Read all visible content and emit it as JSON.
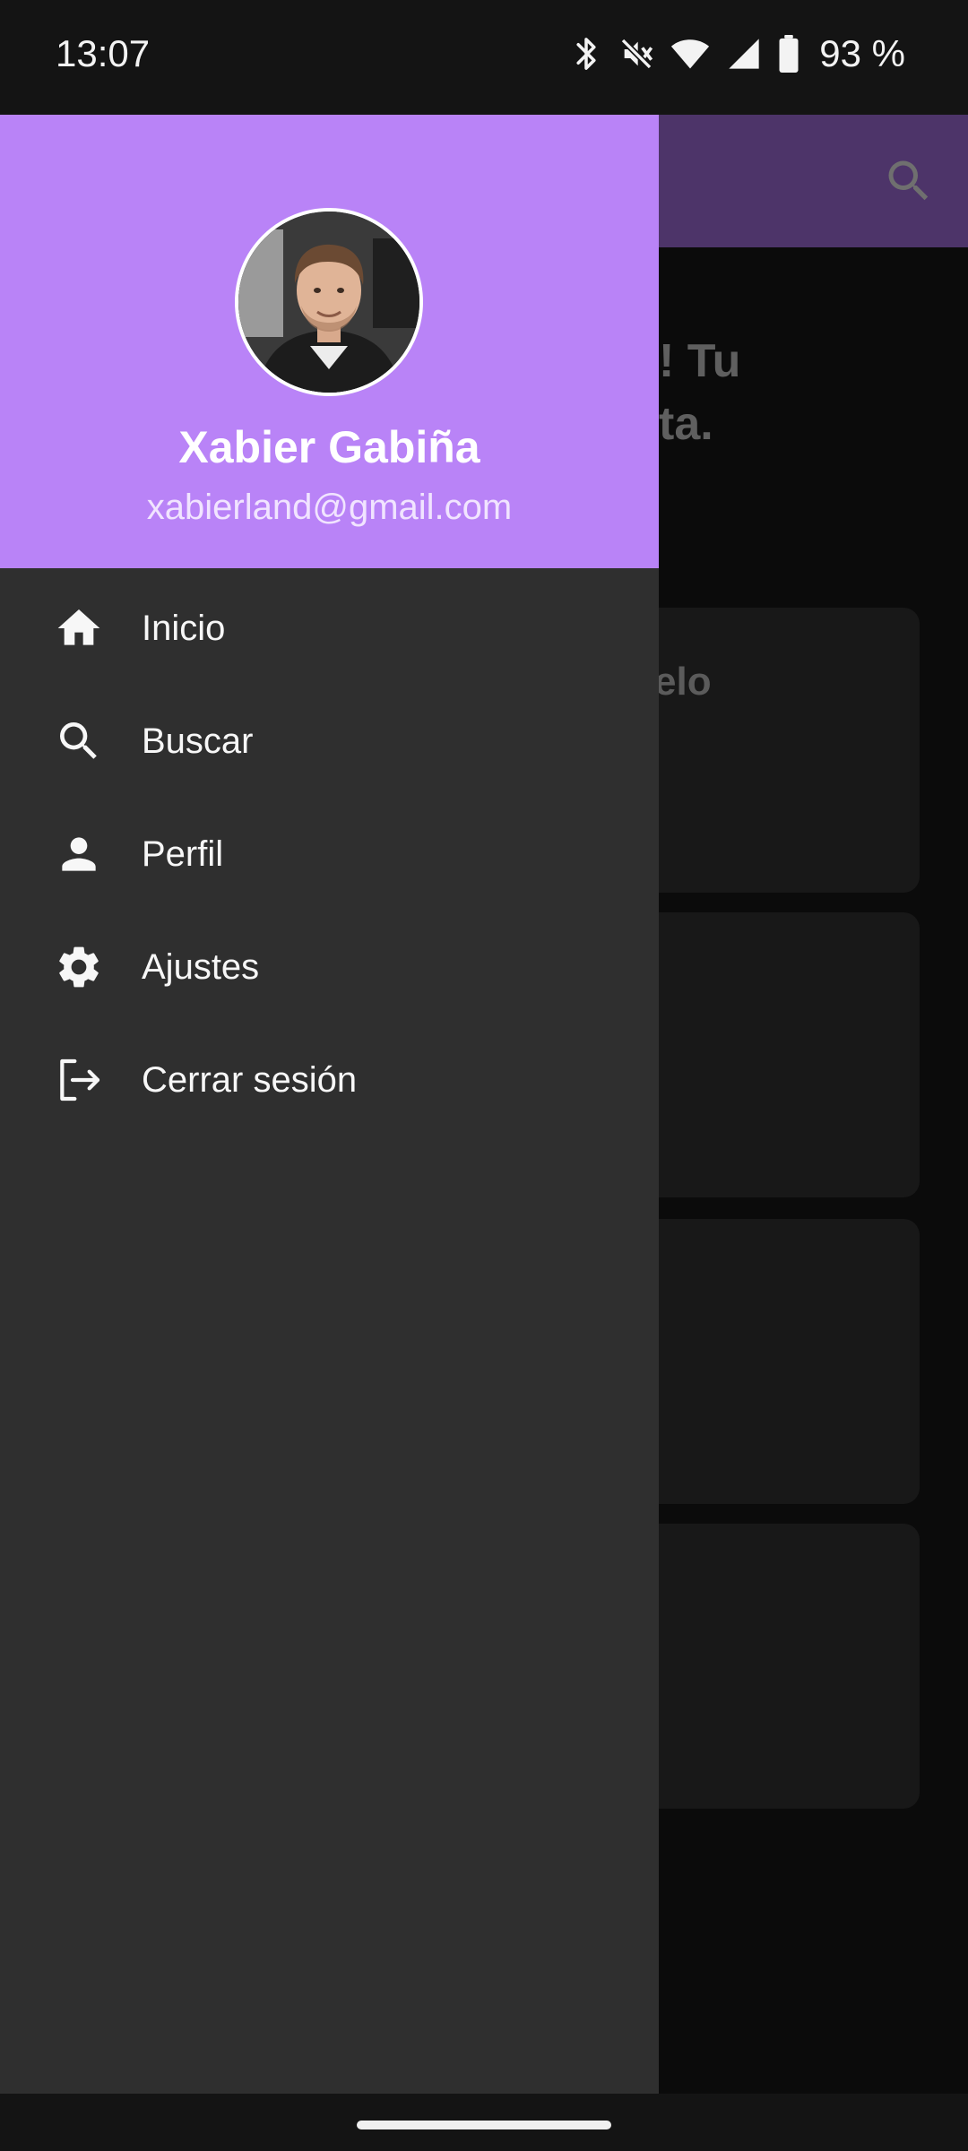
{
  "status_bar": {
    "time": "13:07",
    "battery": "93 %",
    "icons": [
      "bluetooth-icon",
      "mute-icon",
      "wifi-icon",
      "signal-icon",
      "battery-icon"
    ]
  },
  "background_app": {
    "greeting_fragment": "! Tu\nta.",
    "card_title_fragment": "elo",
    "topbar_color": "#4d3469",
    "icons": [
      "search-icon"
    ]
  },
  "drawer": {
    "header_color": "#b983f7",
    "user_name": "Xabier Gabiña",
    "user_email": "xabierland@gmail.com",
    "items": [
      {
        "label": "Inicio",
        "icon": "home-icon"
      },
      {
        "label": "Buscar",
        "icon": "search-icon"
      },
      {
        "label": "Perfil",
        "icon": "person-icon"
      },
      {
        "label": "Ajustes",
        "icon": "gear-icon"
      },
      {
        "label": "Cerrar sesión",
        "icon": "logout-icon"
      }
    ]
  }
}
